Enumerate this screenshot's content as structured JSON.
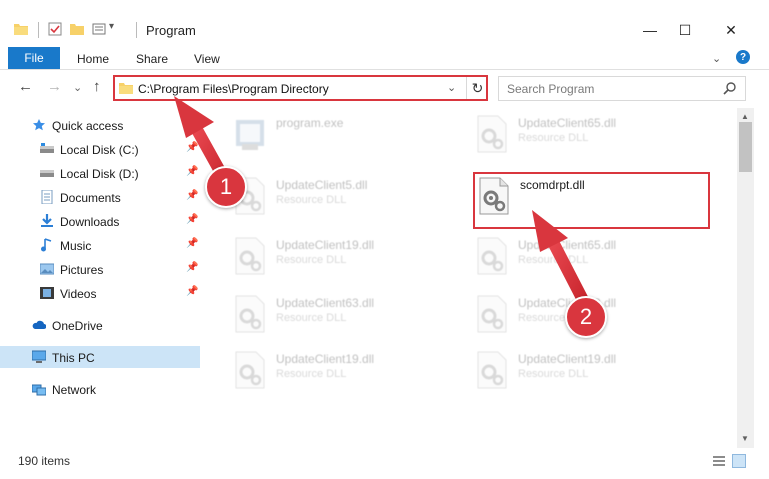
{
  "window": {
    "title": "Program",
    "minimize_glyph": "—",
    "maximize_glyph": "☐",
    "close_glyph": "✕"
  },
  "ribbon": {
    "tabs": [
      "File",
      "Home",
      "Share",
      "View"
    ],
    "expand_glyph": "⌄",
    "help_glyph": "?"
  },
  "address": {
    "back_glyph": "←",
    "forward_glyph": "→",
    "up_glyph": "↑",
    "path": "C:\\Program Files\\Program Directory",
    "dropdown_glyph": "⌄",
    "refresh_glyph": "↻"
  },
  "search": {
    "placeholder": "Search Program"
  },
  "nav": {
    "items": [
      {
        "label": "Quick access",
        "icon": "star-icon"
      },
      {
        "label": "Local Disk (C:)",
        "icon": "drive-icon"
      },
      {
        "label": "Local Disk (D:)",
        "icon": "drive-icon"
      },
      {
        "label": "Documents",
        "icon": "documents-icon"
      },
      {
        "label": "Downloads",
        "icon": "download-icon"
      },
      {
        "label": "Music",
        "icon": "music-icon"
      },
      {
        "label": "Pictures",
        "icon": "pictures-icon"
      },
      {
        "label": "Videos",
        "icon": "videos-icon"
      },
      {
        "label": "OneDrive",
        "icon": "cloud-icon"
      },
      {
        "label": "This PC",
        "icon": "computer-icon"
      },
      {
        "label": "Network",
        "icon": "network-icon"
      }
    ],
    "pin_glyph": "📌"
  },
  "files": [
    {
      "name": "program.exe",
      "type": "",
      "faded": true
    },
    {
      "name": "UpdateClient65.dll",
      "type": "Resource DLL",
      "faded": true
    },
    {
      "name": "UpdateClient5.dll",
      "type": "Resource DLL",
      "faded": true
    },
    {
      "name": "scomdrpt.dll",
      "type": "",
      "faded": false
    },
    {
      "name": "UpdateClient19.dll",
      "type": "Resource DLL",
      "faded": true
    },
    {
      "name": "UpdateClient65.dll",
      "type": "Resource DLL",
      "faded": true
    },
    {
      "name": "UpdateClient63.dll",
      "type": "Resource DLL",
      "faded": true
    },
    {
      "name": "UpdateClient63.dll",
      "type": "Resource DLL",
      "faded": true
    },
    {
      "name": "UpdateClient19.dll",
      "type": "Resource DLL",
      "faded": true
    },
    {
      "name": "UpdateClient19.dll",
      "type": "Resource DLL",
      "faded": true
    }
  ],
  "status": {
    "item_count": "190 items"
  },
  "annotations": {
    "step1": "1",
    "step2": "2",
    "highlight_color": "#d9363e"
  },
  "colors": {
    "accent": "#1979ca",
    "selection": "#cce4f7"
  }
}
